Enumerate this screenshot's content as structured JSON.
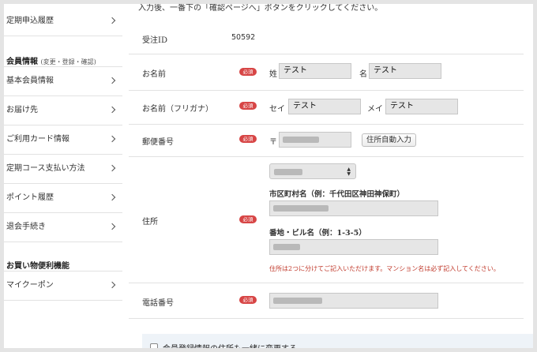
{
  "sidebar": {
    "top_item": "定期申込履歴",
    "member_heading": "会員情報",
    "member_heading_sub": "(変更・登録・確認)",
    "member_items": [
      "基本会員情報",
      "お届け先",
      "ご利用カード情報",
      "定期コース支払い方法",
      "ポイント履歴",
      "退会手続き"
    ],
    "shopping_heading": "お買い物便利機能",
    "shopping_items": [
      "マイクーポン"
    ]
  },
  "form": {
    "top_note": "入力後、一番下の「確認ページへ」ボタンをクリックしてください。",
    "required_badge": "必須",
    "order_id": {
      "label": "受注ID",
      "value": "50592"
    },
    "name": {
      "label": "お名前",
      "last_prefix": "姓",
      "last_value": "テスト",
      "first_prefix": "名",
      "first_value": "テスト"
    },
    "kana": {
      "label": "お名前（フリガナ）",
      "last_prefix": "セイ",
      "last_value": "テスト",
      "first_prefix": "メイ",
      "first_value": "テスト"
    },
    "postal": {
      "label": "郵便番号",
      "prefix": "〒",
      "auto_button": "住所自動入力"
    },
    "address": {
      "label": "住所",
      "city_label": "市区町村名（例：千代田区神田神保町）",
      "street_label": "番地・ビル名（例：1-3-5）",
      "note": "住所は2つに分けてご記入いただけます。マンション名は必ず記入してください。"
    },
    "phone": {
      "label": "電話番号"
    },
    "sync_checkbox": "会員登録情報の住所も一緒に変更する"
  }
}
